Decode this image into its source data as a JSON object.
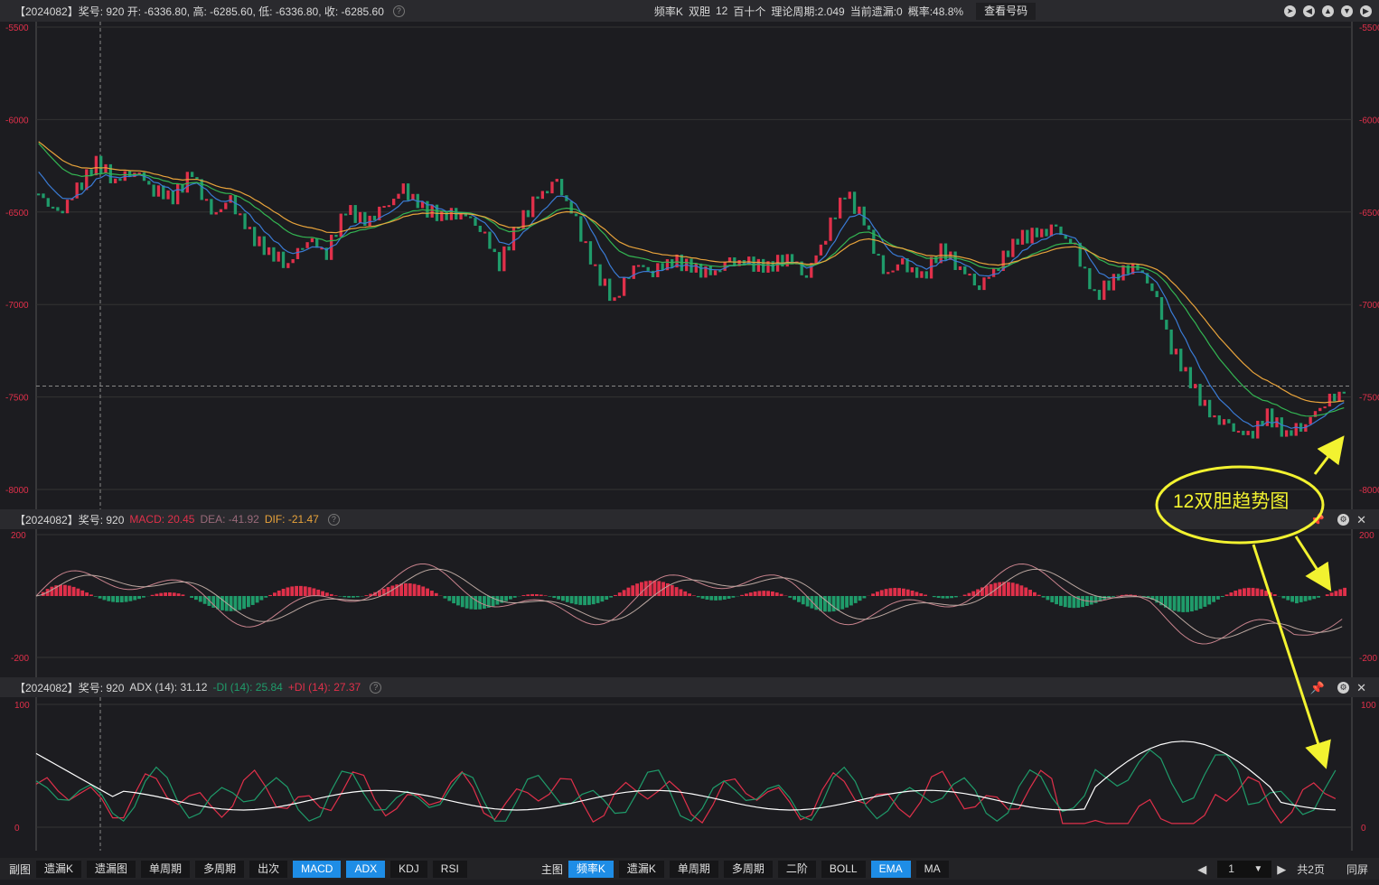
{
  "main_info": {
    "text": "【2024082】奖号: 920  开: -6336.80, 高: -6285.60, 低: -6336.80, 收: -6285.60",
    "mode": "频率K",
    "pair": "双胆",
    "num": "12",
    "group": "百十个",
    "cycle": "理论周期:2.049",
    "miss": "当前遗漏:0",
    "prob": "概率:48.8%",
    "view_btn": "查看号码"
  },
  "macd_info": {
    "prefix": "【2024082】奖号: 920",
    "macd": "MACD: 20.45",
    "dea": "DEA: -41.92",
    "dif": "DIF: -21.47"
  },
  "adx_info": {
    "prefix": "【2024082】奖号: 920",
    "adx": "ADX (14): 31.12",
    "mdi": "-DI (14): 25.84",
    "pdi": "+DI (14): 27.37"
  },
  "annotation": "12双胆趋势图",
  "colors": {
    "up": "#e0304a",
    "down": "#1f9b6a",
    "ema1": "#3a7bd5",
    "ema2": "#33b552",
    "ema3": "#e8a33b",
    "adx": "#ffffff"
  },
  "chart_data": [
    {
      "type": "candlestick",
      "title": "main",
      "y_ticks": [
        "-5500",
        "-6000",
        "-6500",
        "-7000",
        "-7500",
        "-8000"
      ],
      "ylim": [
        -8000,
        -5500
      ],
      "close": [
        -6400,
        -6520,
        -6380,
        -6230,
        -6330,
        -6270,
        -6380,
        -6420,
        -6290,
        -6520,
        -6440,
        -6620,
        -6720,
        -6780,
        -6640,
        -6720,
        -6480,
        -6560,
        -6480,
        -6380,
        -6480,
        -6520,
        -6500,
        -6580,
        -6780,
        -6560,
        -6420,
        -6340,
        -6560,
        -6820,
        -6980,
        -6780,
        -6820,
        -6760,
        -6800,
        -6840,
        -6770,
        -6780,
        -6800,
        -6740,
        -6840,
        -6620,
        -6390,
        -6550,
        -6840,
        -6780,
        -6860,
        -6700,
        -6800,
        -6900,
        -6780,
        -6640,
        -6620,
        -6590,
        -6700,
        -6960,
        -6860,
        -6780,
        -6900,
        -7230,
        -7420,
        -7600,
        -7660,
        -7720,
        -7600,
        -7700,
        -7640,
        -7520,
        -7480
      ],
      "x_last": "2024082",
      "last_value": -6285.6
    },
    {
      "type": "macd",
      "y_ticks": [
        "200",
        "-200"
      ],
      "ylim": [
        -200,
        200
      ],
      "macd": 20.45,
      "dea": -41.92,
      "dif": -21.47
    },
    {
      "type": "adx",
      "y_ticks": [
        "100",
        "0"
      ],
      "ylim": [
        0,
        100
      ],
      "adx": 31.12,
      "mdi": 25.84,
      "pdi": 27.37
    }
  ],
  "bottom_left": [
    "副图",
    "遗漏K",
    "遗漏图",
    "单周期",
    "多周期",
    "出次",
    "MACD",
    "ADX",
    "KDJ",
    "RSI"
  ],
  "bottom_left_active": [
    "MACD",
    "ADX"
  ],
  "bottom_right": [
    "主图",
    "频率K",
    "遗漏K",
    "单周期",
    "多周期",
    "二阶",
    "BOLL",
    "EMA",
    "MA"
  ],
  "bottom_right_active": [
    "频率K",
    "EMA"
  ],
  "pager": {
    "page": "1",
    "total": "共2页",
    "fullscreen": "同屏"
  }
}
